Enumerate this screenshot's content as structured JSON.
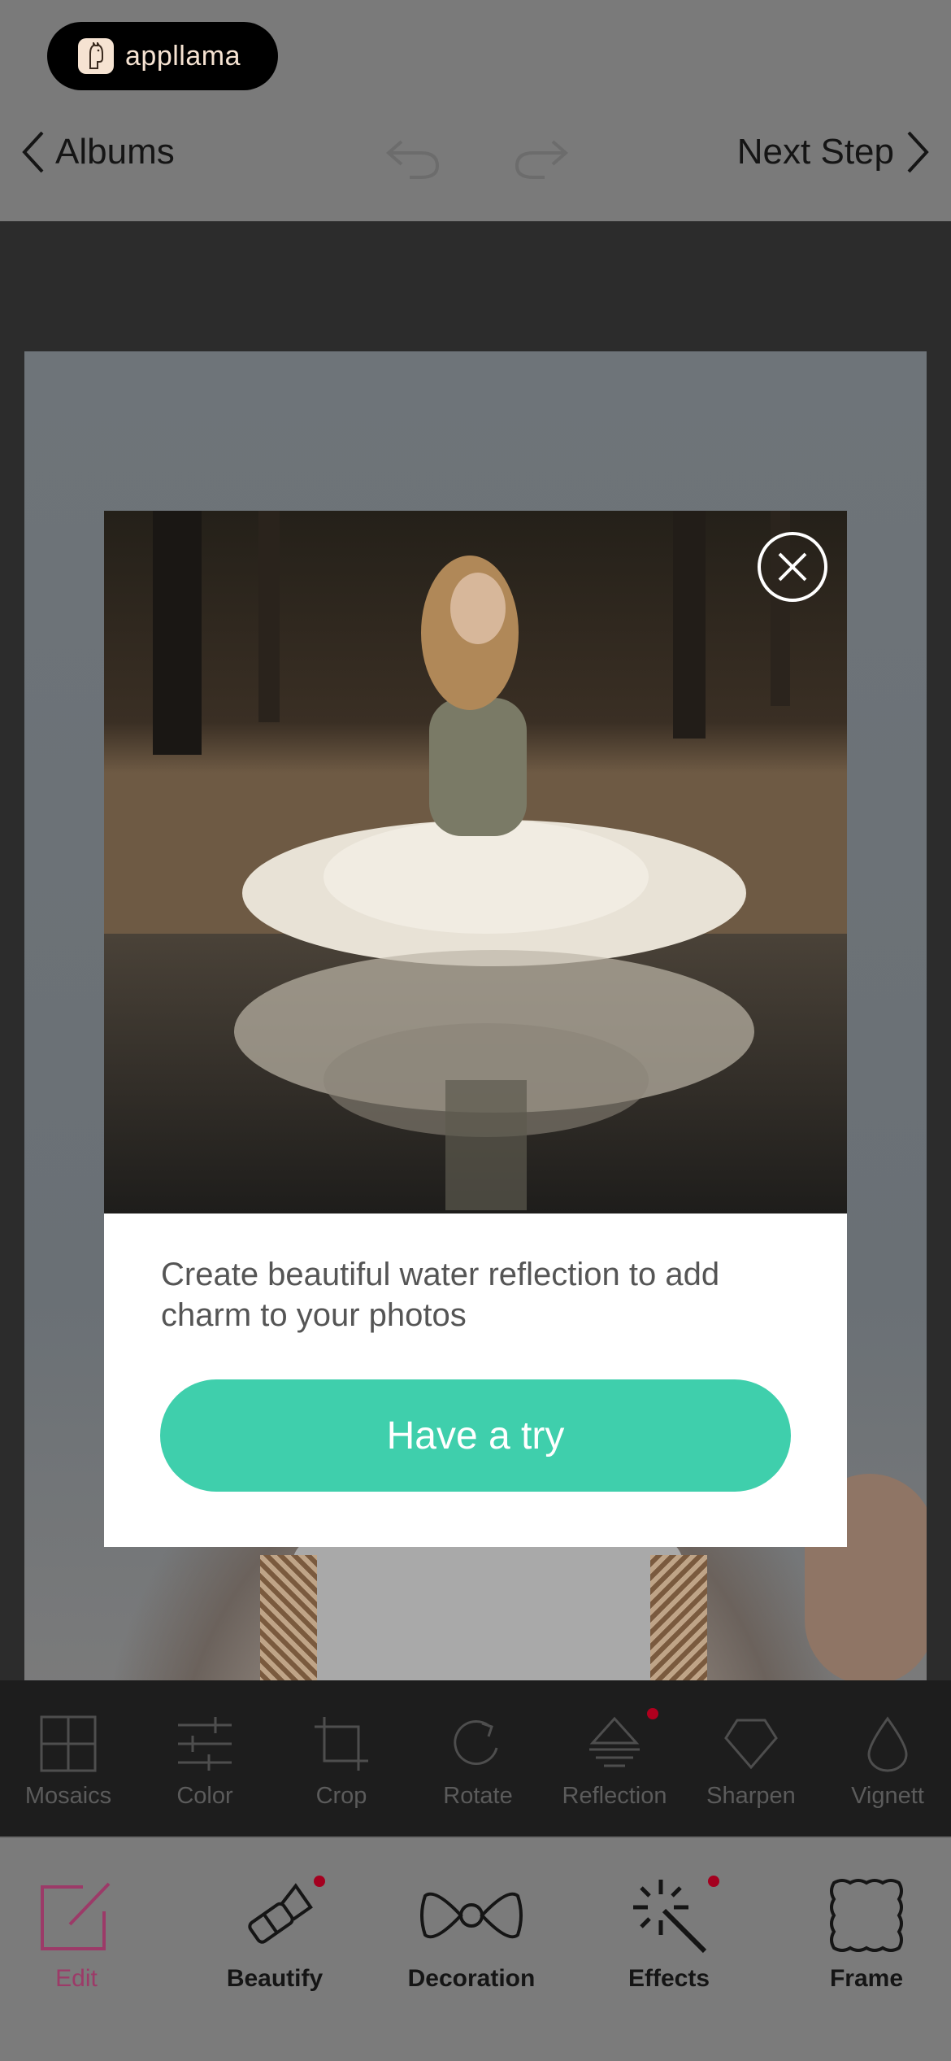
{
  "badge": {
    "brand": "appllama"
  },
  "nav": {
    "back_label": "Albums",
    "next_label": "Next Step"
  },
  "tools": [
    {
      "label": "Mosaics",
      "icon": "mosaic-grid-icon",
      "dot": false
    },
    {
      "label": "Color",
      "icon": "sliders-icon",
      "dot": false
    },
    {
      "label": "Crop",
      "icon": "crop-icon",
      "dot": false
    },
    {
      "label": "Rotate",
      "icon": "rotate-icon",
      "dot": false
    },
    {
      "label": "Reflection",
      "icon": "reflection-icon",
      "dot": true
    },
    {
      "label": "Sharpen",
      "icon": "sharpen-icon",
      "dot": false
    },
    {
      "label": "Vignett",
      "icon": "vignette-drop-icon",
      "dot": false
    }
  ],
  "tabs": [
    {
      "label": "Edit",
      "icon": "edit-icon",
      "active": true,
      "dot": false
    },
    {
      "label": "Beautify",
      "icon": "lipstick-icon",
      "active": false,
      "dot": true
    },
    {
      "label": "Decoration",
      "icon": "bow-icon",
      "active": false,
      "dot": false
    },
    {
      "label": "Effects",
      "icon": "magic-wand-icon",
      "active": false,
      "dot": true
    },
    {
      "label": "Frame",
      "icon": "stamp-frame-icon",
      "active": false,
      "dot": false
    }
  ],
  "modal": {
    "description": "Create beautiful water reflection to add charm to your photos",
    "cta_label": "Have a try"
  },
  "colors": {
    "accent": "#3fcfac",
    "active_tab": "#9c3a68",
    "notification_dot": "#a4001f"
  }
}
